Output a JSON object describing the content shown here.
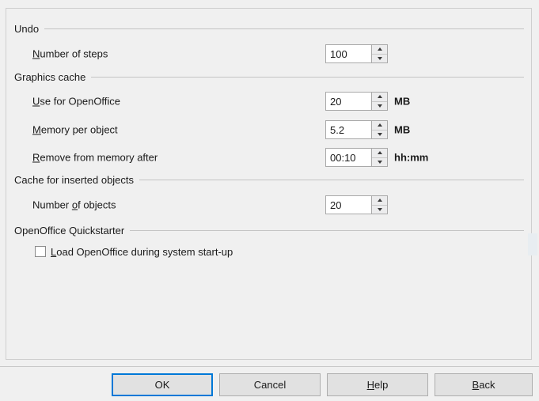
{
  "dialog": {
    "groups": [
      {
        "name": "undo",
        "header": "Undo",
        "fields": [
          {
            "label_pre": "",
            "label_mnemonic": "N",
            "label_post": "umber of steps",
            "value": "100",
            "unit": ""
          }
        ]
      },
      {
        "name": "graphics-cache",
        "header": "Graphics cache",
        "fields": [
          {
            "label_pre": "",
            "label_mnemonic": "U",
            "label_post": "se for OpenOffice",
            "value": "20",
            "unit": "MB"
          },
          {
            "label_pre": "",
            "label_mnemonic": "M",
            "label_post": "emory per object",
            "value": "5.2",
            "unit": "MB"
          },
          {
            "label_pre": "",
            "label_mnemonic": "R",
            "label_post": "emove from memory after",
            "value": "00:10",
            "unit": "hh:mm"
          }
        ]
      },
      {
        "name": "cache-inserted-objects",
        "header": "Cache for inserted objects",
        "fields": [
          {
            "label_pre": "Number ",
            "label_mnemonic": "o",
            "label_post": "f objects",
            "value": "20",
            "unit": ""
          }
        ]
      },
      {
        "name": "quickstarter",
        "header": "OpenOffice Quickstarter",
        "checkbox": {
          "label_pre": "",
          "label_mnemonic": "L",
          "label_post": "oad OpenOffice during system start-up",
          "checked": false
        }
      }
    ],
    "buttons": [
      {
        "name": "ok",
        "label_pre": "OK",
        "label_mnemonic": "",
        "label_post": "",
        "default": true
      },
      {
        "name": "cancel",
        "label_pre": "Cancel",
        "label_mnemonic": "",
        "label_post": "",
        "default": false
      },
      {
        "name": "help",
        "label_pre": "",
        "label_mnemonic": "H",
        "label_post": "elp",
        "default": false
      },
      {
        "name": "back",
        "label_pre": "",
        "label_mnemonic": "B",
        "label_post": "ack",
        "default": false
      }
    ],
    "spinner_icons": {
      "up": "caret-up-icon",
      "down": "caret-down-icon"
    },
    "colors": {
      "background": "#f0f0f0",
      "panel_border": "#cfcfcf",
      "rule": "#c4c4c4",
      "field_border": "#a9a9a9",
      "button_face": "#e1e1e1",
      "button_border": "#adadad",
      "focus_accent": "#0078d7",
      "text": "#1a1a1a"
    }
  }
}
